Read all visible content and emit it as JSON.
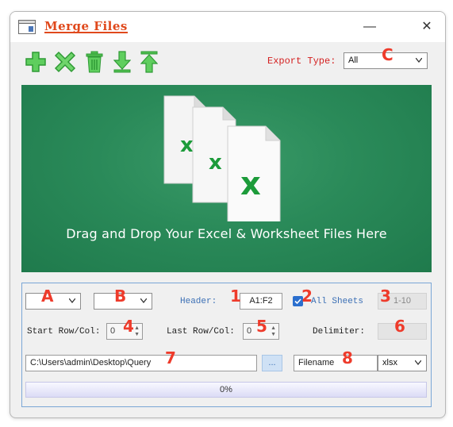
{
  "window": {
    "title": "Merge Files",
    "minimize_glyph": "—",
    "close_glyph": "✕"
  },
  "toolbar": {
    "buttons": [
      {
        "name": "add-file",
        "icon": "plus-icon"
      },
      {
        "name": "remove-file",
        "icon": "x-icon"
      },
      {
        "name": "clear-all",
        "icon": "trash-icon"
      },
      {
        "name": "move-down",
        "icon": "arrow-down-icon"
      },
      {
        "name": "move-up",
        "icon": "arrow-up-icon"
      }
    ],
    "export_type_label": "Export Type:",
    "export_type_value": "All",
    "accent": "#3cb34a"
  },
  "dropzone": {
    "text": "Drag and Drop Your Excel & Worksheet Files Here",
    "background": "#2a8a59"
  },
  "options": {
    "select_a_value": "",
    "select_b_value": "",
    "header_label": "Header:",
    "header_value": "A1:F2",
    "all_sheets_label": "All Sheets",
    "all_sheets_checked": true,
    "sheet_range_value": "1-10",
    "start_row_col_label": "Start Row/Col:",
    "start_row_col_value": "0",
    "last_row_col_label": "Last Row/Col:",
    "last_row_col_value": "0",
    "delimiter_label": "Delimiter:",
    "delimiter_value": "",
    "path_value": "C:\\Users\\admin\\Desktop\\Query",
    "browse_label": "...",
    "filename_value": "Filename",
    "extension_value": "xlsx",
    "progress_text": "0%",
    "progress_fraction": 0
  },
  "markers": {
    "A": "A",
    "B": "B",
    "C": "C",
    "m1": "1",
    "m2": "2",
    "m3": "3",
    "m4": "4",
    "m5": "5",
    "m6": "6",
    "m7": "7",
    "m8": "8",
    "color": "#ee3b2b"
  }
}
